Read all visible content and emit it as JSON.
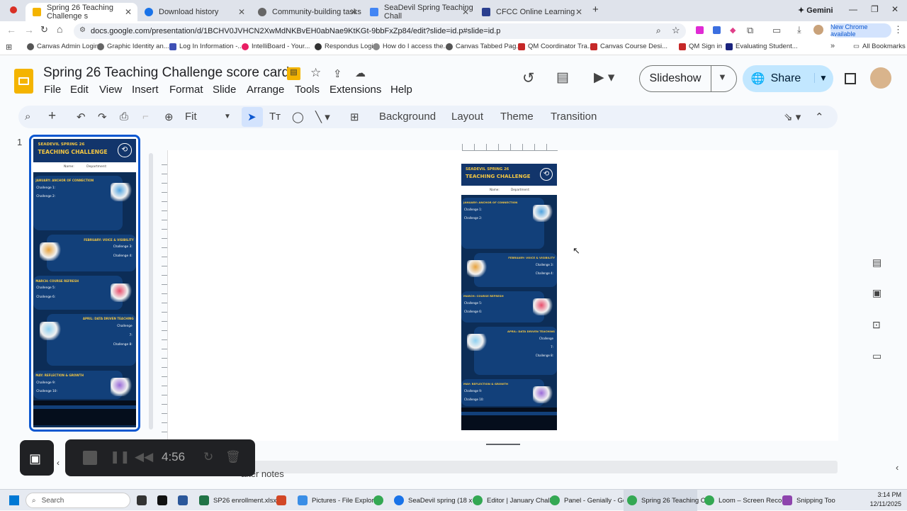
{
  "browser": {
    "tabs": [
      {
        "label": "Spring 26 Teaching Challenge s",
        "active": true
      },
      {
        "label": "Download history"
      },
      {
        "label": "Community-building tasks"
      },
      {
        "label": "SeaDevil Spring Teaching Chall"
      },
      {
        "label": "CFCC Online Learning"
      }
    ],
    "gemini_label": "Gemini",
    "url": "docs.google.com/presentation/d/1BCHV0JVHCN2XwMdNKBvEH0abNae9KtKGt-9bbFxZp84/edit?slide=id.p#slide=id.p",
    "new_chrome_label": "New Chrome available",
    "bookmarks": [
      "Canvas Admin Login",
      "Graphic Identity an...",
      "Log In Information -...",
      "IntelliBoard - Your...",
      "Respondus Login",
      "How do I access the...",
      "Canvas Tabbed Pag...",
      "QM Coordinator Tra...",
      "Canvas Course Desi...",
      "QM Sign in",
      "Evaluating Student..."
    ],
    "all_bookmarks_label": "All Bookmarks"
  },
  "doc": {
    "title": "Spring 26 Teaching Challenge score card",
    "menus": [
      "File",
      "Edit",
      "View",
      "Insert",
      "Format",
      "Slide",
      "Arrange",
      "Tools",
      "Extensions",
      "Help"
    ],
    "slideshow_label": "Slideshow",
    "share_label": "Share",
    "zoom_label": "Fit",
    "toolbar_buttons": [
      "Background",
      "Layout",
      "Theme",
      "Transition"
    ],
    "slide_number": "1",
    "speaker_notes_label": "aker notes"
  },
  "slide": {
    "header_line1": "SEADEVIL SPRING 26",
    "header_line2": "TEACHING CHALLENGE",
    "name_label": "Name:",
    "department_label": "Department:",
    "sections": [
      {
        "title": "JANUARY: ANCHOR OF CONNECTION",
        "challenges": [
          "Challenge 1:",
          "Challenge 2:"
        ]
      },
      {
        "title": "FEBRUARY: VOICE & VISIBILITY",
        "challenges": [
          "Challenge 3:",
          "Challenge 4:"
        ]
      },
      {
        "title": "MARCH: COURSE REFRESH",
        "challenges": [
          "Challenge 5:",
          "Challenge 6:"
        ]
      },
      {
        "title": "APRIL: DATA DRIVEN TEACHING",
        "challenges": [
          "Challenge",
          "7:",
          "Challenge 8:"
        ]
      },
      {
        "title": "MAY: REFLECTION & GROWTH",
        "challenges": [
          "Challenge 9:",
          "Challenge 10:"
        ]
      }
    ]
  },
  "recorder": {
    "time": "4:56"
  },
  "taskbar": {
    "search_placeholder": "Search",
    "apps": [
      "SP26 enrollment.xlsx",
      "Pictures - File Explor",
      "SeaDevil spring (18 x",
      "Editor | January Chall",
      "Panel - Genially - Go",
      "Spring 26 Teaching C",
      "Loom – Screen Recor",
      "Snipping Too"
    ],
    "time": "3:14 PM",
    "date": "12/11/2025"
  },
  "colors": {
    "slide_bg": "#0c2d57",
    "accent_yellow": "#f3c642",
    "docs_yellow": "#f4b400",
    "share_bg": "#c2e7ff"
  }
}
